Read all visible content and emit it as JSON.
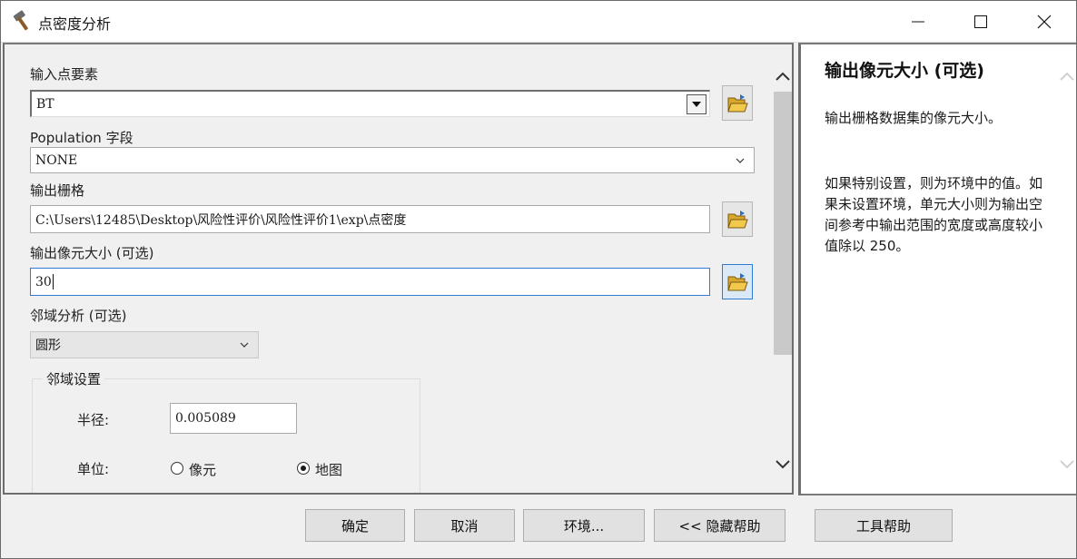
{
  "window": {
    "title": "点密度分析",
    "icon": "hammer-icon",
    "controls": [
      "minimize-icon",
      "maximize-icon",
      "close-icon"
    ]
  },
  "form": {
    "input_points": {
      "label": "输入点要素",
      "value": "BT"
    },
    "population_field": {
      "label": "Population 字段",
      "value": "NONE"
    },
    "output_raster": {
      "label": "输出栅格",
      "value": "C:\\Users\\12485\\Desktop\\风险性评价\\风险性评价1\\exp\\点密度"
    },
    "cell_size": {
      "label": "输出像元大小 (可选)",
      "value": "30"
    },
    "neighborhood": {
      "label": "邻域分析 (可选)",
      "value": "圆形"
    },
    "neighborhood_settings": {
      "title": "邻域设置",
      "radius_label": "半径:",
      "radius_value": "0.005089",
      "units_label": "单位:",
      "unit_options": [
        {
          "label": "像元",
          "checked": false
        },
        {
          "label": "地图",
          "checked": true
        }
      ]
    }
  },
  "help": {
    "title": "输出像元大小 (可选)",
    "paragraph1": "输出栅格数据集的像元大小。",
    "paragraph2": "如果特别设置，则为环境中的值。如果未设置环境，单元大小则为输出空间参考中输出范围的宽度或高度较小值除以 250。"
  },
  "buttons": {
    "ok": "确定",
    "cancel": "取消",
    "environments": "环境...",
    "hide_help": "<< 隐藏帮助",
    "tool_help": "工具帮助"
  },
  "colors": {
    "focus_border": "#2f7bd6",
    "folder_yellow": "#f2c94c"
  }
}
